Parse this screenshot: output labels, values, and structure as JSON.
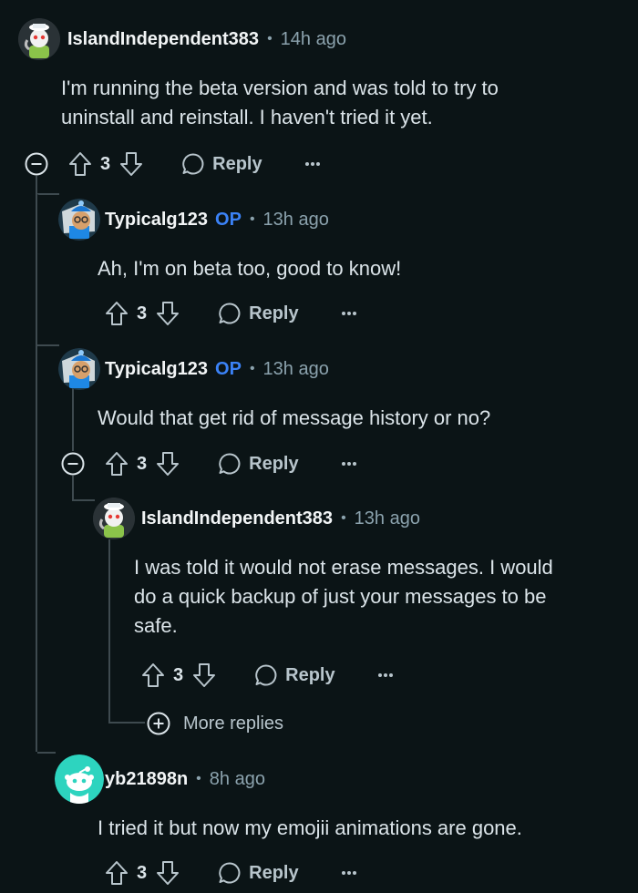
{
  "comments": [
    {
      "username": "IslandIndependent383",
      "time": "14h ago",
      "text_lines": [
        "I'm running the beta version and was told to try to",
        "uninstall and reinstall. I haven't tried it yet."
      ],
      "votes": "3",
      "reply_label": "Reply",
      "avatar_icon": "snoo-avatar-sailor-hat"
    },
    {
      "username": "Typicalg123",
      "op_badge": "OP",
      "time": "13h ago",
      "text_lines": [
        "Ah, I'm on beta too, good to know!"
      ],
      "votes": "3",
      "reply_label": "Reply",
      "avatar_icon": "snoo-avatar-beanie"
    },
    {
      "username": "Typicalg123",
      "op_badge": "OP",
      "time": "13h ago",
      "text_lines": [
        "Would that get rid of message history or no?"
      ],
      "votes": "3",
      "reply_label": "Reply",
      "avatar_icon": "snoo-avatar-beanie"
    },
    {
      "username": "IslandIndependent383",
      "time": "13h ago",
      "text_lines": [
        "I was told it would not erase messages. I would",
        "do a quick backup of just your messages to be",
        "safe."
      ],
      "votes": "3",
      "reply_label": "Reply",
      "avatar_icon": "snoo-avatar-sailor-hat"
    },
    {
      "username": "yb21898n",
      "time": "8h ago",
      "text_lines": [
        "I tried it but now my emojii animations are gone."
      ],
      "votes": "3",
      "reply_label": "Reply",
      "avatar_icon": "snoo-avatar-default"
    }
  ],
  "more_replies_label": "More replies",
  "colors": {
    "background": "#0b1416",
    "op_badge": "#3b82f6",
    "thread_line": "#3e4a4f",
    "default_avatar_bg": "#2dd4bf"
  }
}
